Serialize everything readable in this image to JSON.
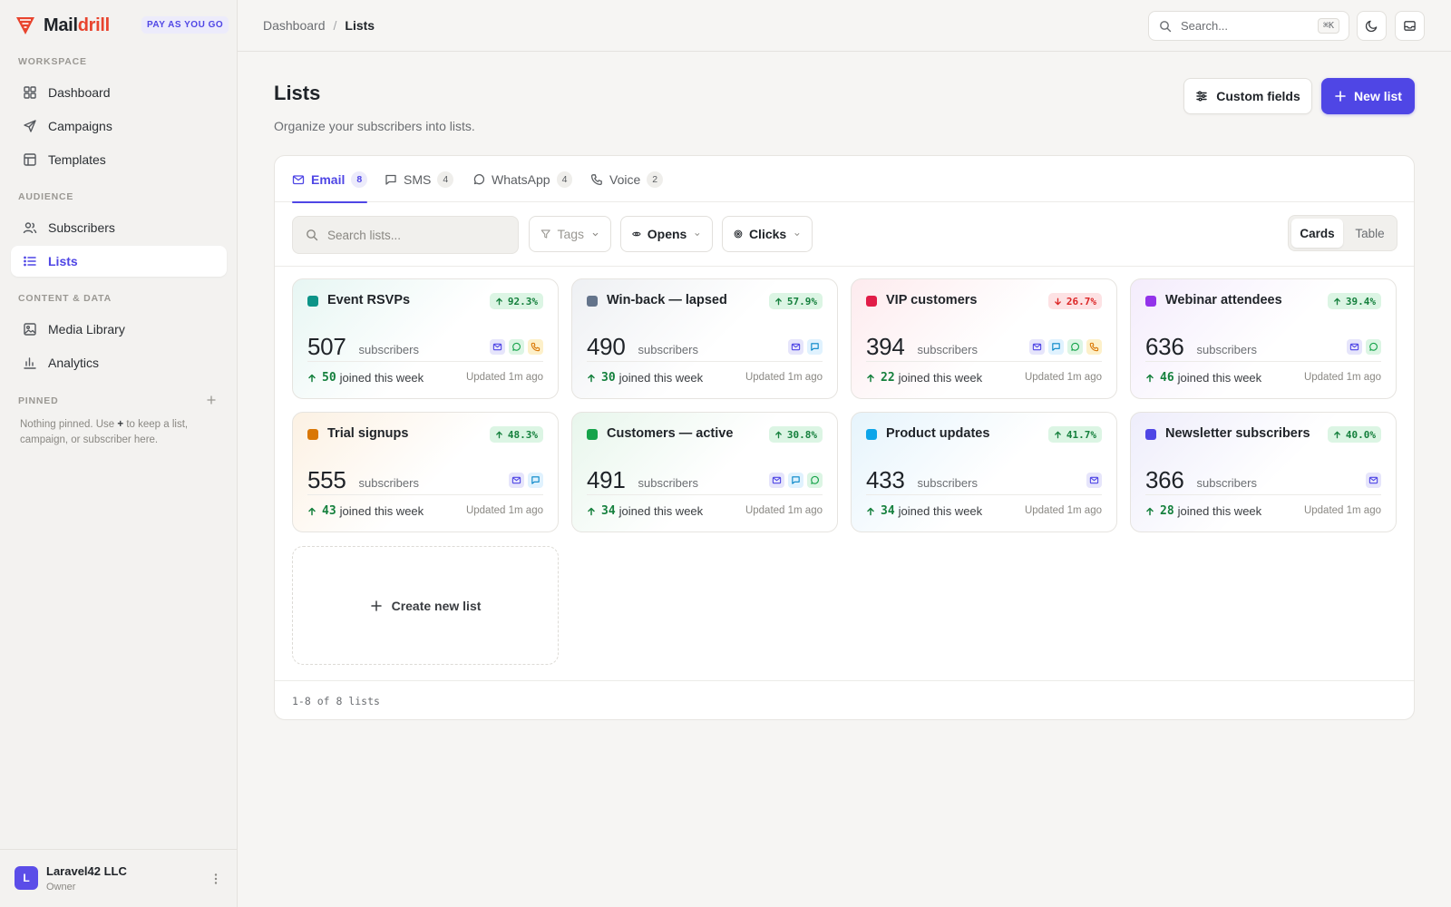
{
  "app": {
    "name_main": "Mail",
    "name_accent": "drill",
    "plan": "PAY AS YOU GO",
    "brand_color": "#e8442e",
    "accent_color": "#4f46e5"
  },
  "sidebar": {
    "workspace_label": "WORKSPACE",
    "audience_label": "AUDIENCE",
    "content_label": "CONTENT & DATA",
    "pinned_label": "PINNED",
    "items": [
      {
        "label": "Dashboard",
        "icon": "grid-icon"
      },
      {
        "label": "Campaigns",
        "icon": "send-icon"
      },
      {
        "label": "Templates",
        "icon": "layout-icon"
      },
      {
        "label": "Subscribers",
        "icon": "users-icon"
      },
      {
        "label": "Lists",
        "icon": "list-icon",
        "active": true
      },
      {
        "label": "Media Library",
        "icon": "image-icon"
      },
      {
        "label": "Analytics",
        "icon": "bar-chart-icon"
      }
    ],
    "pinned_empty_pre": "Nothing pinned. Use ",
    "pinned_empty_plus": "+",
    "pinned_empty_post": " to keep a list, campaign, or subscriber here.",
    "account": {
      "initial": "L",
      "name": "Laravel42 LLC",
      "role": "Owner"
    }
  },
  "topbar": {
    "breadcrumb": [
      "Dashboard",
      "Lists"
    ],
    "search_placeholder": "Search...",
    "search_shortcut": "⌘K"
  },
  "header": {
    "title": "Lists",
    "subtitle": "Organize your subscribers into lists.",
    "custom_fields_label": "Custom fields",
    "new_list_label": "New list"
  },
  "tabs": [
    {
      "label": "Email",
      "count": "8",
      "active": true
    },
    {
      "label": "SMS",
      "count": "4"
    },
    {
      "label": "WhatsApp",
      "count": "4"
    },
    {
      "label": "Voice",
      "count": "2"
    }
  ],
  "toolbar": {
    "search_placeholder": "Search lists...",
    "filters": [
      {
        "label": "Tags"
      },
      {
        "label": "Opens"
      },
      {
        "label": "Clicks"
      }
    ],
    "view_cards": "Cards",
    "view_table": "Table"
  },
  "cards": [
    {
      "name": "Event RSVPs",
      "color": "#0d9488",
      "tint": "#e7f6f3",
      "trend": "92.3%",
      "dir": "up",
      "count": "507",
      "channels": [
        "email",
        "wa",
        "voice"
      ],
      "joined": "50"
    },
    {
      "name": "Win-back — lapsed",
      "color": "#64748b",
      "tint": "#eef0f3",
      "trend": "57.9%",
      "dir": "up",
      "count": "490",
      "channels": [
        "email",
        "sms"
      ],
      "joined": "30"
    },
    {
      "name": "VIP customers",
      "color": "#e11d48",
      "tint": "#fdebee",
      "trend": "26.7%",
      "dir": "down",
      "count": "394",
      "channels": [
        "email",
        "sms",
        "wa",
        "voice"
      ],
      "joined": "22"
    },
    {
      "name": "Webinar attendees",
      "color": "#9333ea",
      "tint": "#f4ecfc",
      "trend": "39.4%",
      "dir": "up",
      "count": "636",
      "channels": [
        "email",
        "wa"
      ],
      "joined": "46"
    },
    {
      "name": "Trial signups",
      "color": "#d97706",
      "tint": "#fcf1e3",
      "trend": "48.3%",
      "dir": "up",
      "count": "555",
      "channels": [
        "email",
        "sms"
      ],
      "joined": "43"
    },
    {
      "name": "Customers — active",
      "color": "#16a34a",
      "tint": "#e8f6ec",
      "trend": "30.8%",
      "dir": "up",
      "count": "491",
      "channels": [
        "email",
        "sms",
        "wa"
      ],
      "joined": "34"
    },
    {
      "name": "Product updates",
      "color": "#0ea5e9",
      "tint": "#e6f4fc",
      "trend": "41.7%",
      "dir": "up",
      "count": "433",
      "channels": [
        "email"
      ],
      "joined": "34"
    },
    {
      "name": "Newsletter subscribers",
      "color": "#4f46e5",
      "tint": "#eeedfb",
      "trend": "40.0%",
      "dir": "up",
      "count": "366",
      "channels": [
        "email"
      ],
      "joined": "28"
    }
  ],
  "card_labels": {
    "unit": "subscribers",
    "joined_suffix": "joined this week",
    "updated": "Updated 1m ago"
  },
  "create_card_label": "Create new list",
  "footer": {
    "pagination": "1-8 of 8 lists"
  }
}
